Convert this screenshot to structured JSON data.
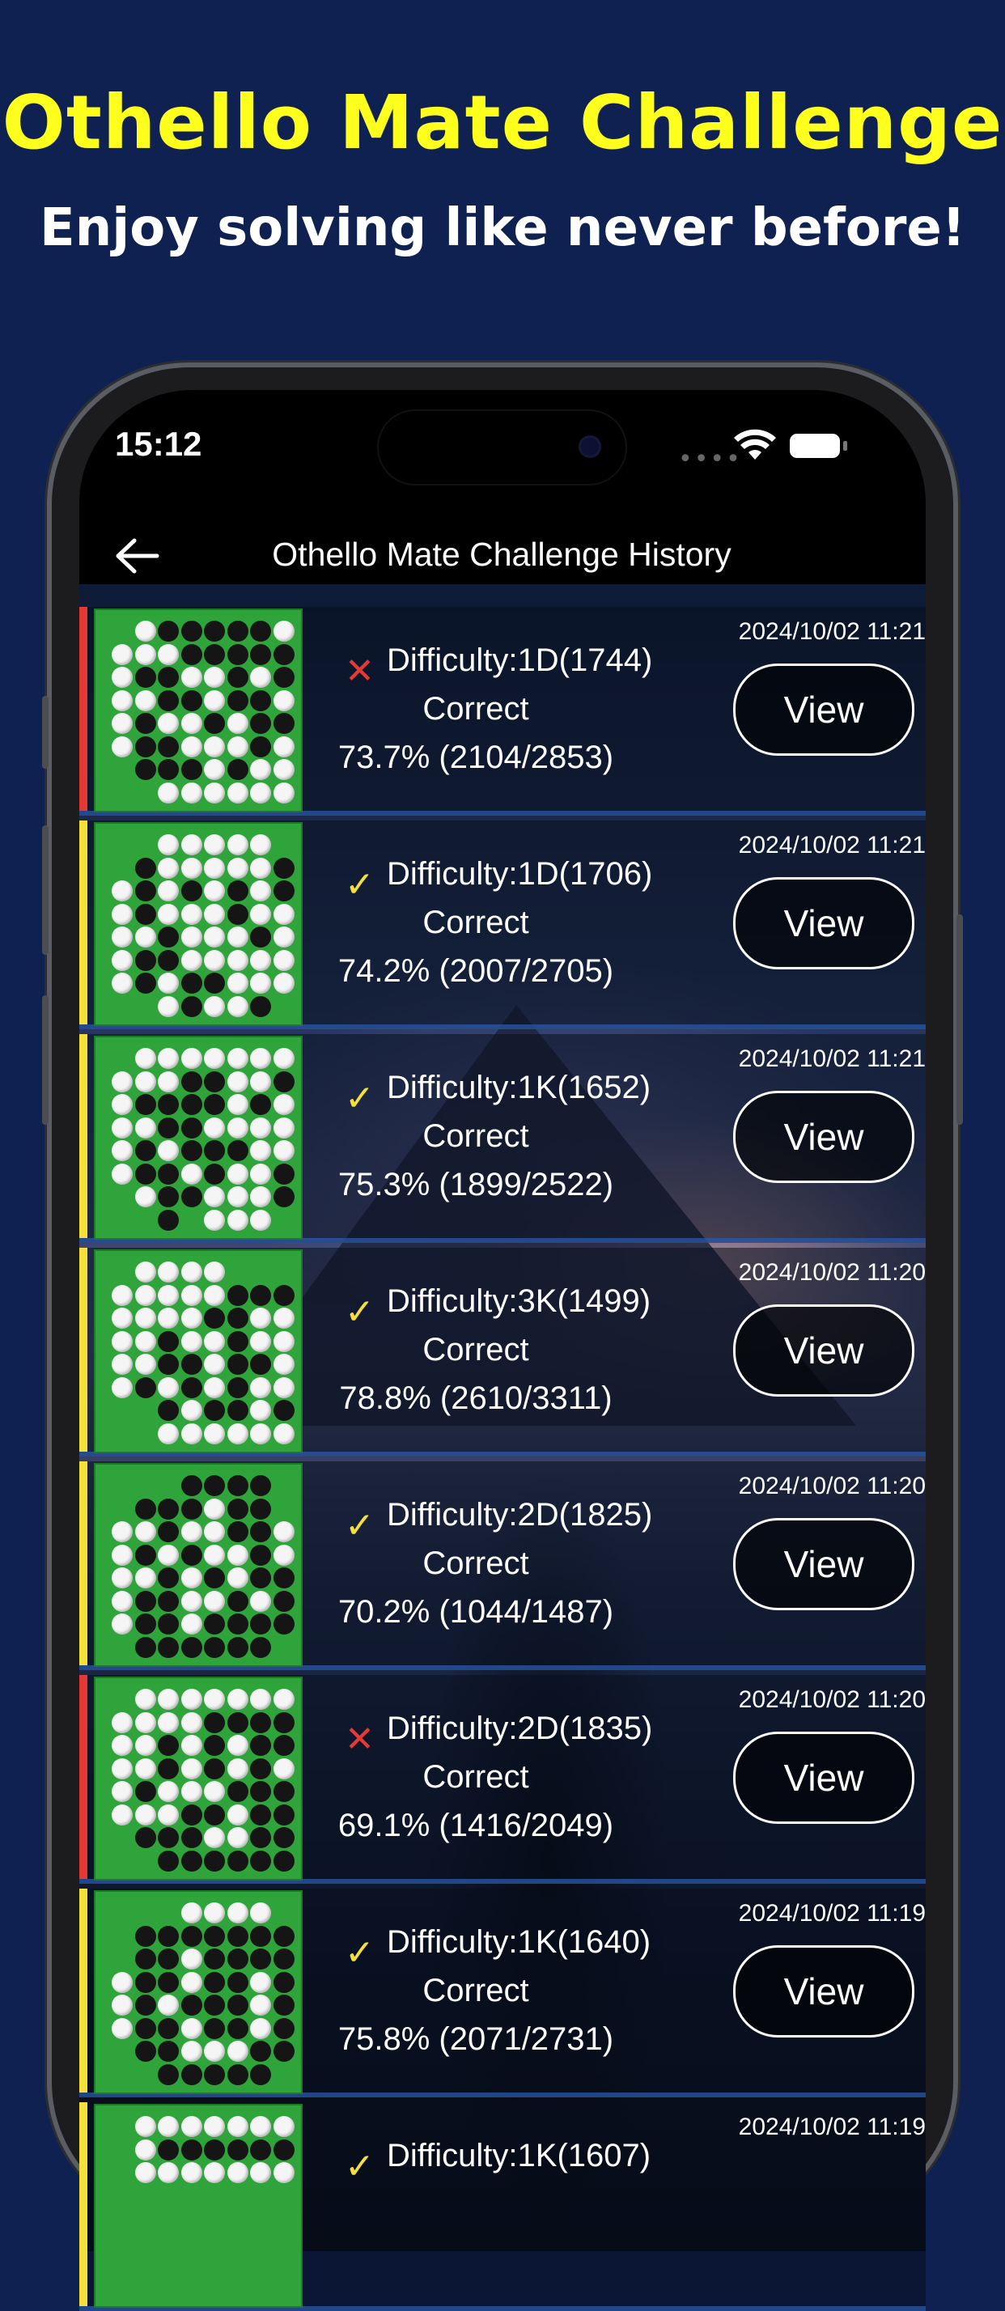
{
  "promo": {
    "title": "Othello Mate Challenge",
    "subtitle": "Enjoy solving like never before!"
  },
  "status_bar": {
    "time": "15:12"
  },
  "app_bar": {
    "title": "Othello Mate Challenge History",
    "back_icon": "arrow-left-icon"
  },
  "colors": {
    "background": "#0f2150",
    "promo_title": "#ffff1e",
    "fail": "#e53935",
    "pass": "#f5e03a",
    "board": "#2ea43a",
    "separator": "#285aaa"
  },
  "history": [
    {
      "date": "2024/10/02 11:21",
      "result": "fail",
      "mark": "✕",
      "difficulty": "Difficulty:1D(1744)",
      "label": "Correct",
      "rate": "73.7% (2104/2853)",
      "button": "View"
    },
    {
      "date": "2024/10/02 11:21",
      "result": "pass",
      "mark": "✓",
      "difficulty": "Difficulty:1D(1706)",
      "label": "Correct",
      "rate": "74.2% (2007/2705)",
      "button": "View"
    },
    {
      "date": "2024/10/02 11:21",
      "result": "pass",
      "mark": "✓",
      "difficulty": "Difficulty:1K(1652)",
      "label": "Correct",
      "rate": "75.3% (1899/2522)",
      "button": "View"
    },
    {
      "date": "2024/10/02 11:20",
      "result": "pass",
      "mark": "✓",
      "difficulty": "Difficulty:3K(1499)",
      "label": "Correct",
      "rate": "78.8% (2610/3311)",
      "button": "View"
    },
    {
      "date": "2024/10/02 11:20",
      "result": "pass",
      "mark": "✓",
      "difficulty": "Difficulty:2D(1825)",
      "label": "Correct",
      "rate": "70.2% (1044/1487)",
      "button": "View"
    },
    {
      "date": "2024/10/02 11:20",
      "result": "fail",
      "mark": "✕",
      "difficulty": "Difficulty:2D(1835)",
      "label": "Correct",
      "rate": "69.1% (1416/2049)",
      "button": "View"
    },
    {
      "date": "2024/10/02 11:19",
      "result": "pass",
      "mark": "✓",
      "difficulty": "Difficulty:1K(1640)",
      "label": "Correct",
      "rate": "75.8% (2071/2731)",
      "button": "View"
    },
    {
      "date": "2024/10/02 11:19",
      "result": "pass",
      "mark": "✓",
      "difficulty": "Difficulty:1K(1607)",
      "label": "",
      "rate": "",
      "button": ""
    }
  ]
}
